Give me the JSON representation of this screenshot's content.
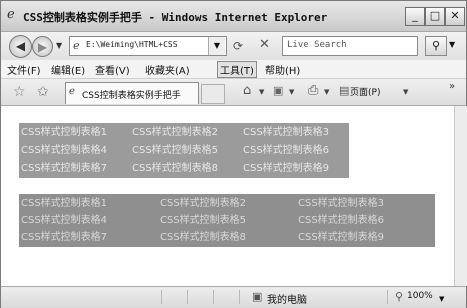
{
  "window": {
    "title": "CSS控制表格实例手把手 - Windows Internet Explorer",
    "minimize": "_",
    "maximize": "□",
    "close": "✕"
  },
  "address_bar": {
    "url": "E:\\Weiming\\HTML+CSS",
    "search_placeholder": "Live Search"
  },
  "menu": [
    "文件(F)",
    "编辑(E)",
    "查看(V)",
    "收藏夹(A)",
    "工具(T)",
    "帮助(H)"
  ],
  "menu_active_index": 4,
  "tab": {
    "label": "CSS控制表格实例手把手"
  },
  "toolbar": {
    "page_label": "页面(P)",
    "more": "»"
  },
  "table1": {
    "rows": [
      [
        "CSS样式控制表格1",
        "CSS样式控制表格2",
        "CSS样式控制表格3"
      ],
      [
        "CSS样式控制表格4",
        "CSS样式控制表格5",
        "CSS样式控制表格6"
      ],
      [
        "CSS样式控制表格7",
        "CSS样式控制表格8",
        "CSS样式控制表格9"
      ]
    ]
  },
  "table2": {
    "rows": [
      [
        "CSS样式控制表格1",
        "CSS样式控制表格2",
        "CSS样式控制表格3"
      ],
      [
        "CSS样式控制表格4",
        "CSS样式控制表格5",
        "CSS样式控制表格6"
      ],
      [
        "CSS样式控制表格7",
        "CSS样式控制表格8",
        "CSS样式控制表格9"
      ]
    ]
  },
  "status_bar": {
    "zone": "我的电脑",
    "zoom": "100%"
  },
  "icons": {
    "ie": "ie-logo-icon",
    "back": "back-arrow-icon",
    "forward": "forward-arrow-icon",
    "refresh": "refresh-icon",
    "stop": "stop-icon",
    "search": "magnifier-icon",
    "favorites": "star-icon",
    "add_favorite": "add-favorite-icon",
    "home": "home-icon",
    "feeds": "feeds-icon",
    "print": "printer-icon",
    "page": "page-icon",
    "zone": "computer-icon",
    "zoom": "zoom-icon"
  }
}
